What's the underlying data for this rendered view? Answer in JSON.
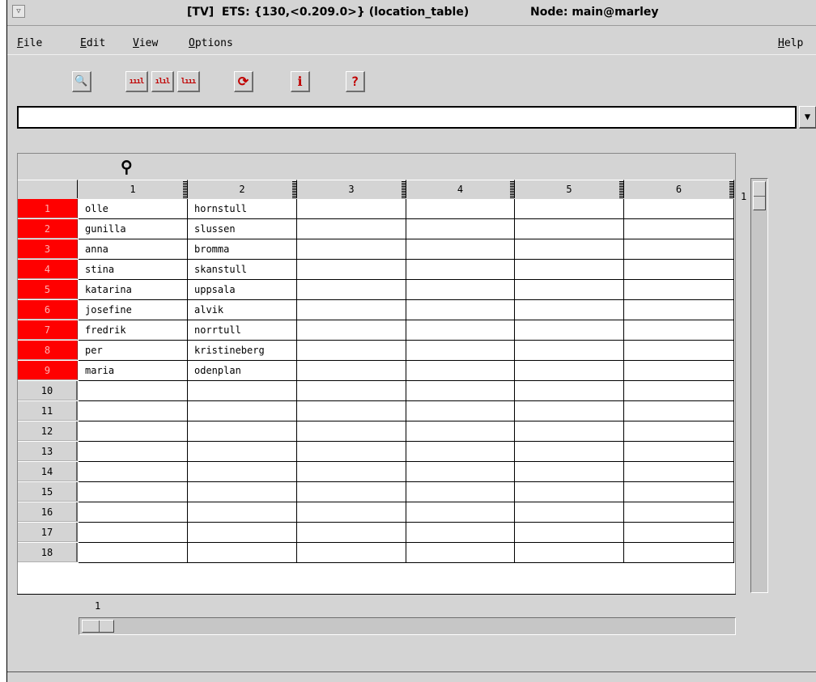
{
  "window": {
    "menu_button_glyph": "▽",
    "title": "[TV]  ETS: {130,<0.209.0>} (location_table)",
    "node": "Node: main@marley"
  },
  "menu": {
    "file": {
      "accel": "F",
      "rest": "ile"
    },
    "edit": {
      "accel": "E",
      "rest": "dit"
    },
    "view": {
      "accel": "V",
      "rest": "iew"
    },
    "options": {
      "accel": "O",
      "rest": "ptions"
    },
    "help": {
      "accel": "H",
      "rest": "elp"
    }
  },
  "toolbar": {
    "search_glyph": "🔍",
    "sort_asc_glyph": "ıııl",
    "sort_mid_glyph": "ılıl",
    "sort_desc_glyph": "lııı",
    "refresh_glyph": "⟳",
    "info_glyph": "i",
    "help_glyph": "?"
  },
  "search": {
    "value": "",
    "arrow": "▼"
  },
  "table": {
    "key_glyph": "⚲",
    "columns": [
      "1",
      "2",
      "3",
      "4",
      "5",
      "6"
    ],
    "rows": [
      {
        "num": "1",
        "c1": "olle",
        "c2": "hornstull"
      },
      {
        "num": "2",
        "c1": "gunilla",
        "c2": "slussen"
      },
      {
        "num": "3",
        "c1": "anna",
        "c2": "bromma"
      },
      {
        "num": "4",
        "c1": "stina",
        "c2": "skanstull"
      },
      {
        "num": "5",
        "c1": "katarina",
        "c2": "uppsala"
      },
      {
        "num": "6",
        "c1": "josefine",
        "c2": "alvik"
      },
      {
        "num": "7",
        "c1": "fredrik",
        "c2": "norrtull"
      },
      {
        "num": "8",
        "c1": "per",
        "c2": "kristineberg"
      },
      {
        "num": "9",
        "c1": "maria",
        "c2": "odenplan"
      },
      {
        "num": "10",
        "c1": "",
        "c2": ""
      },
      {
        "num": "11",
        "c1": "",
        "c2": ""
      },
      {
        "num": "12",
        "c1": "",
        "c2": ""
      },
      {
        "num": "13",
        "c1": "",
        "c2": ""
      },
      {
        "num": "14",
        "c1": "",
        "c2": ""
      },
      {
        "num": "15",
        "c1": "",
        "c2": ""
      },
      {
        "num": "16",
        "c1": "",
        "c2": ""
      },
      {
        "num": "17",
        "c1": "",
        "c2": ""
      },
      {
        "num": "18",
        "c1": "",
        "c2": ""
      }
    ],
    "filled_row_color": "#ff0000",
    "vertical_position": "1",
    "horizontal_position": "1"
  }
}
